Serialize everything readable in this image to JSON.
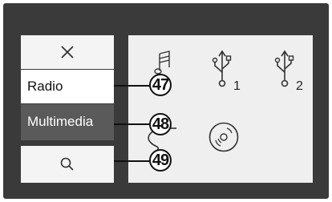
{
  "sidebar": {
    "close_icon": "close-icon",
    "radio_label": "Radio",
    "multimedia_label": "Multimedia",
    "search_icon": "search-icon"
  },
  "sources": {
    "music_icon": "music-note-icon",
    "usb1_label": "1",
    "usb2_label": "2",
    "disc_icon": "disc-icon",
    "aux_icon": "aux-cable-icon"
  },
  "callouts": {
    "radio": "47",
    "multimedia": "48",
    "search": "49"
  },
  "colors": {
    "screen_bg": "#3a3a3a",
    "selected_bg": "#5a5a5a",
    "button_bg": "#f4f4f4",
    "panel_bg": "#efefef"
  }
}
